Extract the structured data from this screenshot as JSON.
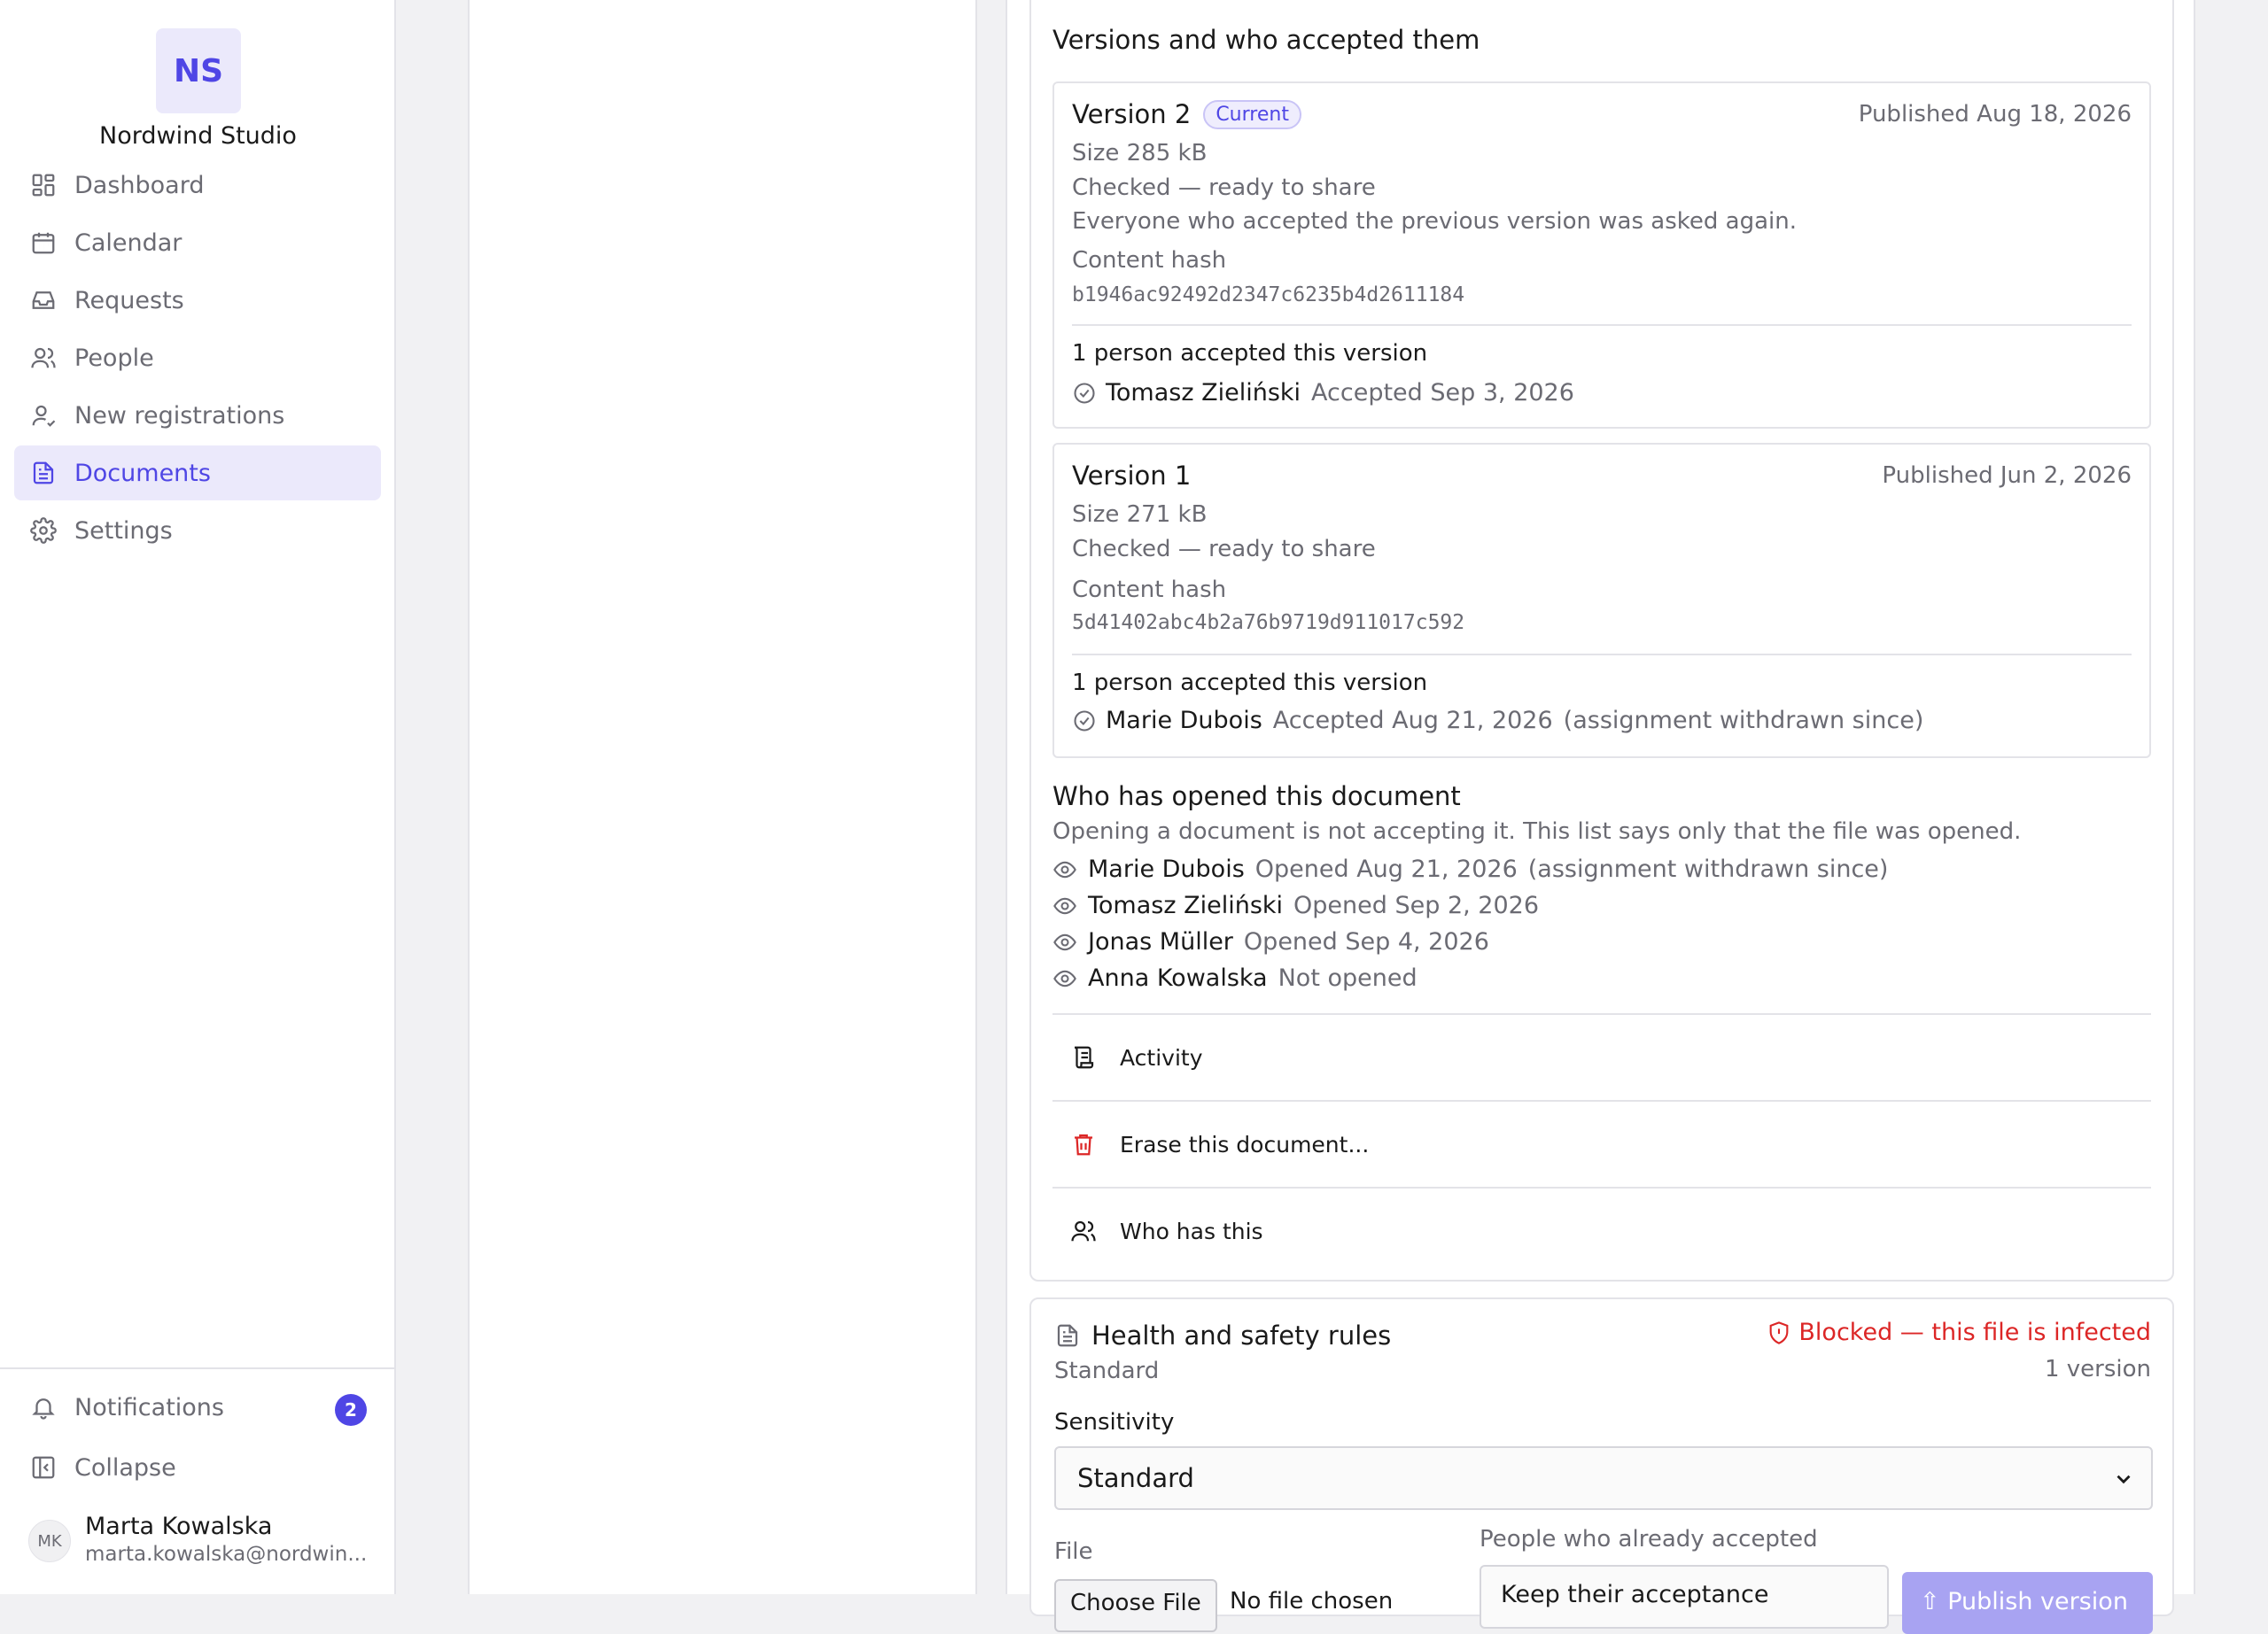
{
  "brand": {
    "initials": "NS",
    "name": "Nordwind Studio"
  },
  "nav": {
    "items": [
      {
        "label": "Dashboard",
        "icon": "dashboard-icon"
      },
      {
        "label": "Calendar",
        "icon": "calendar-icon"
      },
      {
        "label": "Requests",
        "icon": "inbox-icon"
      },
      {
        "label": "People",
        "icon": "people-icon"
      },
      {
        "label": "New registrations",
        "icon": "user-check-icon"
      },
      {
        "label": "Documents",
        "icon": "document-icon",
        "active": true
      },
      {
        "label": "Settings",
        "icon": "gear-icon"
      }
    ]
  },
  "sidebar_bottom": {
    "notifications_label": "Notifications",
    "notifications_count": "2",
    "collapse_label": "Collapse",
    "user_initials": "MK",
    "user_name": "Marta Kowalska",
    "user_email": "marta.kowalska@nordwin..."
  },
  "versions_section": {
    "title": "Versions and who accepted them",
    "versions": [
      {
        "title": "Version 2",
        "badge": "Current",
        "published": "Published Aug 18, 2026",
        "size": "Size 285 kB",
        "status": "Checked — ready to share",
        "note": "Everyone who accepted the previous version was asked again.",
        "hash_label": "Content hash",
        "hash": "b1946ac92492d2347c6235b4d2611184",
        "accepted_count": "1 person accepted this version",
        "acceptances": [
          {
            "name": "Tomasz Zieliński",
            "detail": "Accepted Sep 3, 2026",
            "extra": ""
          }
        ]
      },
      {
        "title": "Version 1",
        "published": "Published Jun 2, 2026",
        "size": "Size 271 kB",
        "status": "Checked — ready to share",
        "hash_label": "Content hash",
        "hash": "5d41402abc4b2a76b9719d911017c592",
        "accepted_count": "1 person accepted this version",
        "acceptances": [
          {
            "name": "Marie Dubois",
            "detail": "Accepted Aug 21, 2026",
            "extra": "(assignment withdrawn since)"
          }
        ]
      }
    ]
  },
  "opened_section": {
    "title": "Who has opened this document",
    "subtitle": "Opening a document is not accepting it. This list says only that the file was opened.",
    "rows": [
      {
        "name": "Marie Dubois",
        "detail": "Opened Aug 21, 2026",
        "extra": "(assignment withdrawn since)"
      },
      {
        "name": "Tomasz Zieliński",
        "detail": "Opened Sep 2, 2026",
        "extra": ""
      },
      {
        "name": "Jonas Müller",
        "detail": "Opened Sep 4, 2026",
        "extra": ""
      },
      {
        "name": "Anna Kowalska",
        "detail": "Not opened",
        "extra": ""
      }
    ]
  },
  "actions": [
    {
      "label": "Activity",
      "icon": "scroll-icon"
    },
    {
      "label": "Erase this document...",
      "icon": "trash-icon",
      "color": "#dc2626"
    },
    {
      "label": "Who has this",
      "icon": "people-icon"
    }
  ],
  "doc2": {
    "title": "Health and safety rules",
    "category": "Standard",
    "status": "Blocked — this file is infected",
    "status_color": "#dc2626",
    "version_count": "1 version",
    "sensitivity_label": "Sensitivity",
    "sensitivity_value": "Standard",
    "file_label": "File",
    "file_button": "Choose File",
    "file_none": "No file chosen",
    "accepted_label": "People who already accepted",
    "accepted_value": "Keep their acceptance",
    "publish_label": "Publish version"
  },
  "colors": {
    "accent": "#4f46e5",
    "danger": "#dc2626",
    "muted": "#6b6b73"
  }
}
